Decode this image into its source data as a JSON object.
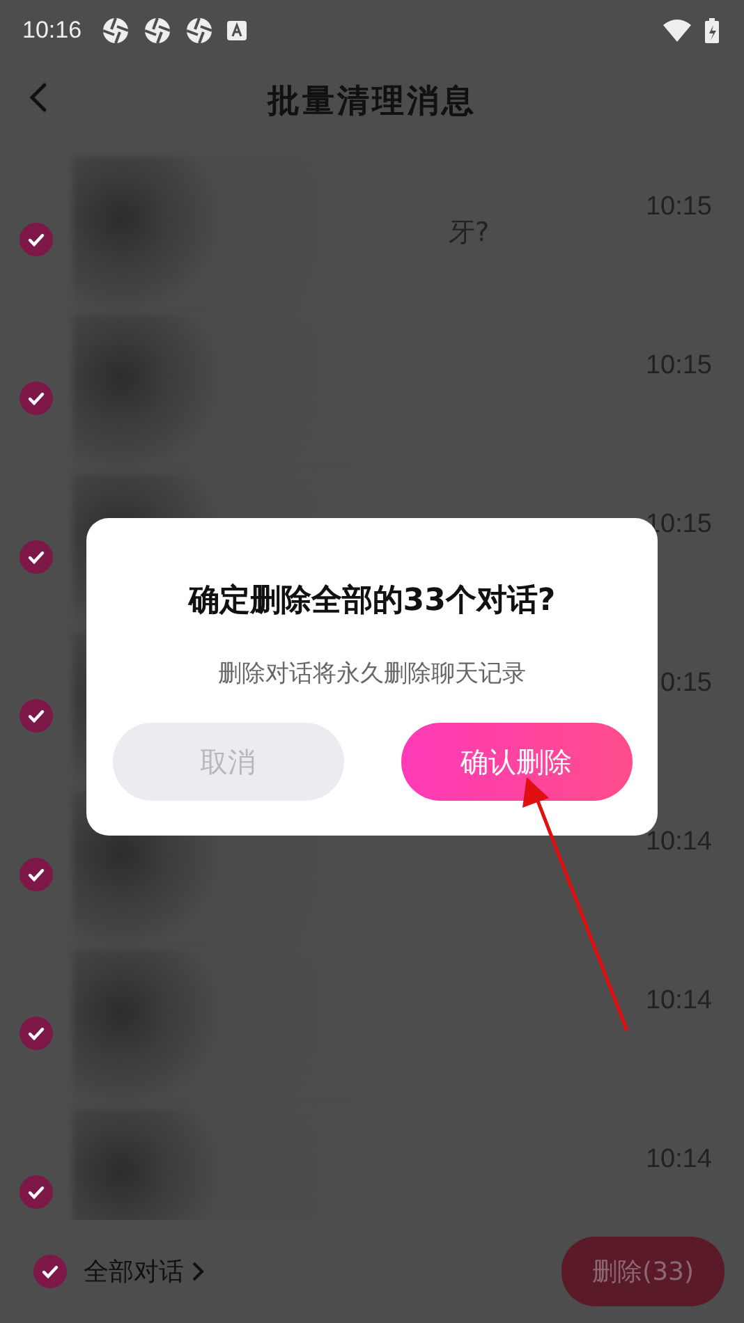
{
  "status_bar": {
    "time": "10:16"
  },
  "header": {
    "title": "批量清理消息"
  },
  "conversations": [
    {
      "time": "10:15",
      "preview": "牙?",
      "selected": true
    },
    {
      "time": "10:15",
      "selected": true
    },
    {
      "time": "10:15",
      "selected": true
    },
    {
      "time": "0:15",
      "selected": true
    },
    {
      "time": "10:14",
      "selected": true
    },
    {
      "time": "10:14",
      "selected": true
    },
    {
      "time": "10:14",
      "selected": true
    }
  ],
  "footer": {
    "select_all": {
      "label": "全部对话",
      "checked": true
    },
    "delete_button": "删除(33)"
  },
  "dialog": {
    "title": "确定删除全部的33个对话?",
    "message": "删除对话将永久删除聊天记录",
    "buttons": [
      {
        "label": "取消",
        "kind": "cancel"
      },
      {
        "label": "确认删除",
        "kind": "confirm"
      }
    ]
  }
}
